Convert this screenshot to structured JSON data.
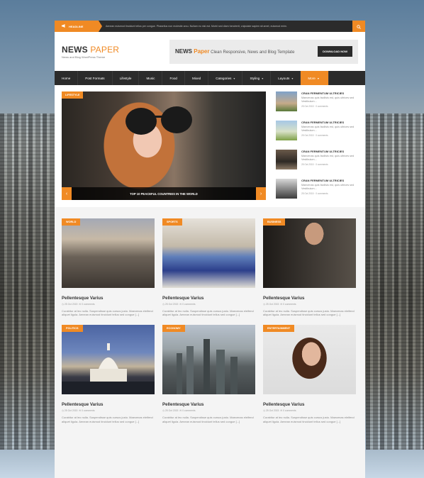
{
  "topbar": {
    "headline_label": "HEADLINE",
    "ticker_text": "Aenean euismod tincidunt tellus per congue. Phasellus non molestie arcu. Nullam eu nisi est. Morbi sed diam hendrerit, vulputate sapien sit amet, euismod enim."
  },
  "header": {
    "logo_main": "NEWS",
    "logo_accent": "PAPER",
    "logo_sub": "News and Blog WordPress Theme",
    "banner_title_main": "NEWS",
    "banner_title_accent": "Paper",
    "banner_text": "Clean Responsive, News and Blog Template",
    "banner_button": "DOWNLOAD NOW"
  },
  "nav": [
    {
      "label": "Home"
    },
    {
      "label": "Post Formats"
    },
    {
      "label": "Lifestyle"
    },
    {
      "label": "Music"
    },
    {
      "label": "Food"
    },
    {
      "label": "Mixed"
    },
    {
      "label": "Categories"
    },
    {
      "label": "Styling"
    },
    {
      "label": "Layouts"
    },
    {
      "label": "More"
    }
  ],
  "slider": {
    "category": "LIFESTYLE",
    "caption": "TOP 10 PEACEFUL COUNTRIES IN THE WORLD",
    "prev": "‹",
    "next": "›"
  },
  "side_posts": [
    {
      "title": "CRAN FERMENTUM ULTRICIES",
      "excerpt": "Maecenas quis facilisis est, quis ultrices sed Vestibulum...",
      "date": "25 Oct 2015",
      "comments": "0 comments"
    },
    {
      "title": "CRAN FERMENTUM ULTRICIES",
      "excerpt": "Maecenas quis facilisis est, quis ultrices sed Vestibulum...",
      "date": "25 Oct 2015",
      "comments": "0 comments"
    },
    {
      "title": "CRAN FERMENTUM ULTRICIES",
      "excerpt": "Maecenas quis facilisis est, quis ultrices sed Vestibulum...",
      "date": "25 Oct 2015",
      "comments": "0 comments"
    },
    {
      "title": "CRAN FERMENTUM ULTRICIES",
      "excerpt": "Maecenas quis facilisis est, quis ultrices sed Vestibulum...",
      "date": "25 Oct 2015",
      "comments": "0 comments"
    }
  ],
  "cards": [
    {
      "category": "WORLD",
      "title": "Pellentesque Varius",
      "date": "25 Oct 2015",
      "comments": "0 comments",
      "excerpt": "Curabitur at leo nulla. Suspendisse quis cursus justo. Maecenas eleifend aliquet ligula. Aenean euismod tincidunt tellus sed congue [...]"
    },
    {
      "category": "SPORTS",
      "title": "Pellentesque Varius",
      "date": "25 Oct 2015",
      "comments": "0 comments",
      "excerpt": "Curabitur at leo nulla. Suspendisse quis cursus justo. Maecenas eleifend aliquet ligula. Aenean euismod tincidunt tellus sed congue [...]"
    },
    {
      "category": "BUSINESS",
      "title": "Pellentesque Varius",
      "date": "25 Oct 2015",
      "comments": "0 comments",
      "excerpt": "Curabitur at leo nulla. Suspendisse quis cursus justo. Maecenas eleifend aliquet ligula. Aenean euismod tincidunt tellus sed congue [...]"
    },
    {
      "category": "POLITICS",
      "title": "Pellentesque Varius",
      "date": "25 Oct 2015",
      "comments": "0 comments",
      "excerpt": "Curabitur at leo nulla. Suspendisse quis cursus justo. Maecenas eleifend aliquet ligula. Aenean euismod tincidunt tellus sed congue [...]"
    },
    {
      "category": "ECONOMY",
      "title": "Pellentesque Varius",
      "date": "25 Oct 2015",
      "comments": "0 comments",
      "excerpt": "Curabitur at leo nulla. Suspendisse quis cursus justo. Maecenas eleifend aliquet ligula. Aenean euismod tincidunt tellus sed congue [...]"
    },
    {
      "category": "ENTERTAINMENT",
      "title": "Pellentesque Varius",
      "date": "25 Oct 2015",
      "comments": "0 comments",
      "excerpt": "Curabitur at leo nulla. Suspendisse quis cursus justo. Maecenas eleifend aliquet ligula. Aenean euismod tincidunt tellus sed congue [...]"
    }
  ],
  "colors": {
    "accent": "#f08a24",
    "dark": "#2b2b2b"
  },
  "icons": {
    "headline": "megaphone-icon",
    "search": "search-icon",
    "date": "calendar-icon",
    "comments": "comment-icon"
  }
}
